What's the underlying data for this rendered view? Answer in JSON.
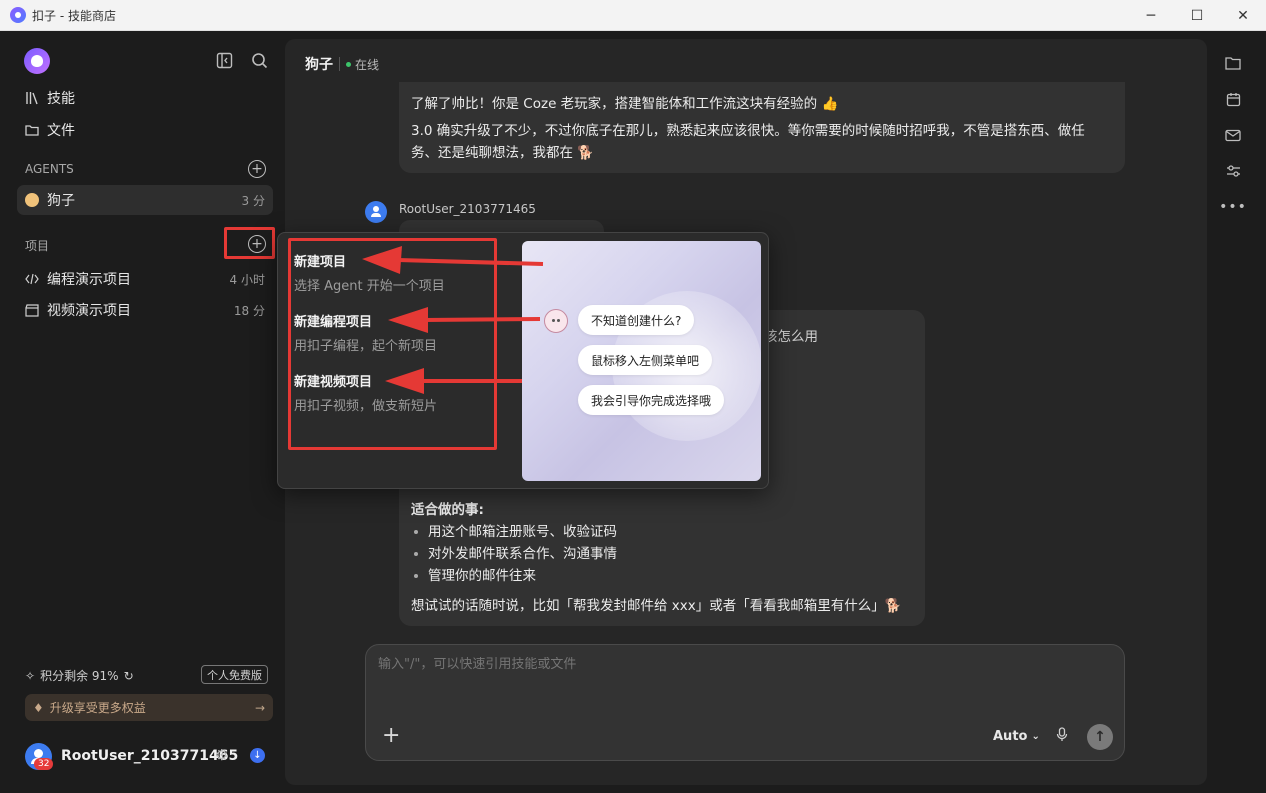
{
  "window": {
    "title": "扣子 - 技能商店",
    "controls": {
      "minimize": "─",
      "maximize": "☐",
      "close": "✕"
    }
  },
  "sidebar": {
    "nav": [
      {
        "label": "技能",
        "icon": "library-icon"
      },
      {
        "label": "文件",
        "icon": "folder-icon"
      }
    ],
    "agents_section": "AGENTS",
    "agents": [
      {
        "name": "狗子",
        "time": "3 分"
      }
    ],
    "projects_section": "项目",
    "projects": [
      {
        "name": "编程演示项目",
        "time": "4 小时",
        "icon": "code-icon"
      },
      {
        "name": "视频演示项目",
        "time": "18 分",
        "icon": "clapperboard-icon"
      }
    ],
    "quota": "积分剩余 91%",
    "plan": "个人免费版",
    "upgrade": "升级享受更多权益",
    "user": {
      "name": "RootUser_2103771465",
      "badge": "32"
    }
  },
  "chat": {
    "agent_name": "狗子",
    "status": "在线",
    "msg1_line1": "了解了帅比！你是 Coze 老玩家，搭建智能体和工作流这块有经验的 👍",
    "msg1_line2": "3.0 确实升级了不少，不过你底子在那儿，熟悉起来应该很快。等你需要的时候随时招呼我，不管是搭东西、做任",
    "msg1_line3": "务、还是纯聊想法，我都在 🐕",
    "user_name": "RootUser_2103771465",
    "partial_text": "该怎么用",
    "suitable_title": "适合做的事:",
    "bullets": [
      "用这个邮箱注册账号、收验证码",
      "对外发邮件联系合作、沟通事情",
      "管理你的邮件往来"
    ],
    "closing": "想试试的话随时说，比如「帮我发封邮件给 xxx」或者「看看我邮箱里有什么」🐕"
  },
  "composer": {
    "placeholder": "输入\"/\"，可以快速引用技能或文件",
    "model": "Auto"
  },
  "popup": {
    "items": [
      {
        "title": "新建项目",
        "desc": "选择 Agent 开始一个项目"
      },
      {
        "title": "新建编程项目",
        "desc": "用扣子编程，起个新项目"
      },
      {
        "title": "新建视频项目",
        "desc": "用扣子视频，做支新短片"
      }
    ],
    "preview_chips": [
      "不知道创建什么?",
      "鼠标移入左侧菜单吧",
      "我会引导你完成选择哦"
    ]
  },
  "colors": {
    "highlight": "#e53935",
    "online": "#3cc46a",
    "accent": "#3d7cf0"
  }
}
